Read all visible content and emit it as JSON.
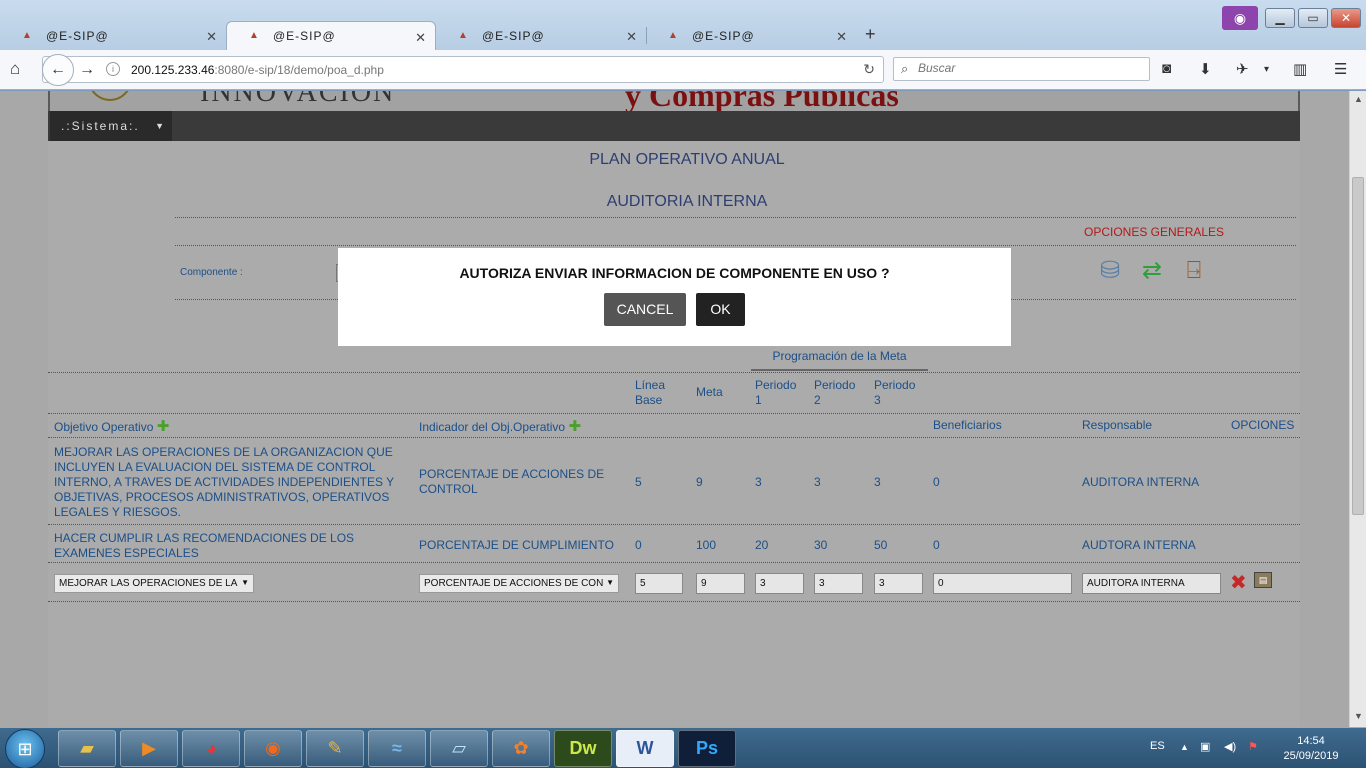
{
  "browser": {
    "tabs": [
      {
        "title": "@E-SIP@",
        "active": false
      },
      {
        "title": "@E-SIP@",
        "active": true
      },
      {
        "title": "@E-SIP@",
        "active": false
      },
      {
        "title": "@E-SIP@",
        "active": false
      }
    ],
    "url_host": "200.125.233.46",
    "url_path": ":8080/e-sip/18/demo/poa_d.php",
    "search_placeholder": "Buscar"
  },
  "page": {
    "banner_left": "INNOVACION",
    "banner_right": "y Compras Publicas",
    "system_menu": ".:Sistema:.",
    "title": "PLAN OPERATIVO ANUAL",
    "subtitle": "AUDITORIA INTERNA",
    "options_label": "OPCIONES GENERALES",
    "component_label": "Componente :",
    "programming_header": "Programación de la Meta",
    "columns": {
      "linea_base": "Línea Base",
      "meta": "Meta",
      "periodo1": "Periodo 1",
      "periodo2": "Periodo 2",
      "periodo3": "Periodo 3",
      "objetivo": "Objetivo Operativo",
      "indicador": "Indicador del Obj.Operativo",
      "beneficiarios": "Beneficiarios",
      "responsable": "Responsable",
      "opciones": "OPCIONES"
    },
    "rows": [
      {
        "objetivo": "MEJORAR LAS OPERACIONES DE LA ORGANIZACION QUE INCLUYEN LA EVALUACION DEL SISTEMA DE CONTROL INTERNO, A TRAVES DE ACTIVIDADES INDEPENDIENTES Y OBJETIVAS, PROCESOS ADMINISTRATIVOS, OPERATIVOS LEGALES Y RIESGOS.",
        "indicador": "PORCENTAJE DE ACCIONES DE CONTROL",
        "linea_base": "5",
        "meta": "9",
        "p1": "3",
        "p2": "3",
        "p3": "3",
        "beneficiarios": "0",
        "responsable": "AUDITORA INTERNA"
      },
      {
        "objetivo": "HACER CUMPLIR LAS RECOMENDACIONES DE LOS EXAMENES ESPECIALES",
        "indicador": "PORCENTAJE DE CUMPLIMIENTO",
        "linea_base": "0",
        "meta": "100",
        "p1": "20",
        "p2": "30",
        "p3": "50",
        "beneficiarios": "0",
        "responsable": "AUDTORA INTERNA"
      }
    ],
    "edit_row": {
      "objetivo": "MEJORAR LAS OPERACIONES DE LA",
      "indicador": "PORCENTAJE DE ACCIONES DE CON",
      "linea_base": "5",
      "meta": "9",
      "p1": "3",
      "p2": "3",
      "p3": "3",
      "beneficiarios": "0",
      "responsable": "AUDITORA INTERNA"
    }
  },
  "modal": {
    "message": "AUTORIZA ENVIAR INFORMACION DE COMPONENTE EN USO ?",
    "cancel_label": "CANCEL",
    "ok_label": "OK"
  },
  "taskbar": {
    "language": "ES",
    "time": "14:54",
    "date": "25/09/2019"
  },
  "colors": {
    "accent_text": "#1c4f88",
    "title_text": "#2c3e72",
    "options_red": "#b01a1a",
    "modal_bg": "#ffffff"
  }
}
